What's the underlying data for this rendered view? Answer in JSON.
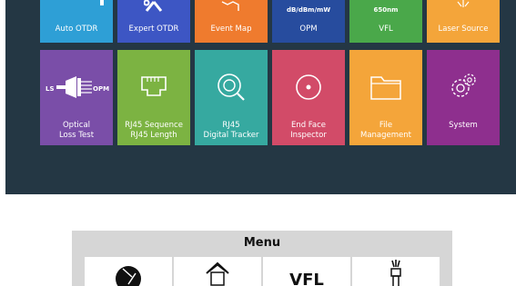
{
  "app_grid": {
    "tiles": [
      {
        "id": "auto-otdr",
        "label": "Auto OTDR",
        "color": "#2e9fd6",
        "icon": "otdr-icon"
      },
      {
        "id": "expert-otdr",
        "label": "Expert OTDR",
        "color": "#3d56c4",
        "icon": "tools-icon"
      },
      {
        "id": "event-map",
        "label": "Event Map",
        "color": "#ef7b2e",
        "icon": "map-icon"
      },
      {
        "id": "opm",
        "label": "OPM",
        "units": "dB/dBm/mW",
        "color": "#274c9e",
        "icon": "power-meter-icon"
      },
      {
        "id": "vfl",
        "label": "VFL",
        "wavelength": "650nm",
        "color": "#4aa84a",
        "icon": "laser-icon"
      },
      {
        "id": "laser-source",
        "label": "Laser Source",
        "color": "#f4a53a",
        "icon": "light-source-icon"
      },
      {
        "id": "optical-loss-test",
        "label_line1": "Optical",
        "label_line2": "Loss Test",
        "ls_tag": "LS",
        "opm_tag": "OPM",
        "color": "#7a4ea8",
        "icon": "loss-test-icon"
      },
      {
        "id": "rj45-sequence",
        "label_line1": "RJ45 Sequence",
        "label_line2": "RJ45 Length",
        "color": "#7cb342",
        "icon": "rj45-port-icon"
      },
      {
        "id": "rj45-tracker",
        "label_line1": "RJ45",
        "label_line2": "Digital Tracker",
        "color": "#36a9a0",
        "icon": "tracker-icon"
      },
      {
        "id": "end-face",
        "label_line1": "End Face",
        "label_line2": "Inspector",
        "color": "#d24b68",
        "icon": "inspector-icon"
      },
      {
        "id": "file-management",
        "label_line1": "File",
        "label_line2": "Management",
        "color": "#f4a53a",
        "icon": "folder-icon"
      },
      {
        "id": "system",
        "label": "System",
        "color": "#8e2f8e",
        "icon": "gear-icon"
      }
    ]
  },
  "menu": {
    "title": "Menu",
    "items": [
      {
        "icon": "aperture-icon"
      },
      {
        "icon": "home-icon"
      },
      {
        "text": "VFL",
        "icon": "vfl-icon"
      },
      {
        "icon": "light-source-icon"
      }
    ]
  }
}
